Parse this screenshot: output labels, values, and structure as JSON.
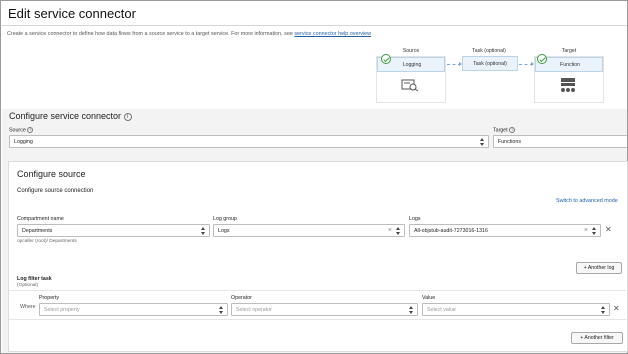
{
  "header": {
    "title": "Edit service connector",
    "intro": "Create a service connector to define how data flows from a source service to a target service. For more information, see ",
    "intro_link": "service connector help overview"
  },
  "flow": {
    "source_label": "Source",
    "source_value": "Logging",
    "task_label": "Task (optional)",
    "task_value": "Task (optional)",
    "target_label": "Target",
    "target_value": "Function"
  },
  "configure_connector": {
    "title": "Configure service connector",
    "source_label": "Source",
    "source_value": "Logging",
    "target_label": "Target",
    "target_value": "Functions"
  },
  "configure_source": {
    "title": "Configure source",
    "subtitle": "Configure source connection",
    "advanced_link": "Switch to advanced mode",
    "compartment_label": "Compartment name",
    "compartment_value": "Departments",
    "compartment_path": "opcaller (root)/ Departments",
    "log_group_label": "Log group",
    "log_group_value": "Logs",
    "logs_label": "Logs",
    "logs_value": "All-objstub-audit-7273016-1316",
    "another_log": "Another log",
    "filter_title": "Log filter task",
    "filter_optional": "(Optional)",
    "where_label": "Where",
    "property_label": "Property",
    "property_placeholder": "Select property",
    "operator_label": "Operator",
    "operator_placeholder": "Select operator",
    "value_label": "Value",
    "value_placeholder": "Select value",
    "another_filter": "Another filter"
  },
  "icons": {
    "check": "check-circle-icon",
    "logging": "logging-icon",
    "function": "function-icon",
    "help": "help-icon",
    "clear": "clear-x-icon",
    "remove": "remove-x-icon",
    "plus": "plus-icon"
  },
  "colors": {
    "accent": "#1f5fa8",
    "flow_box": "#eaf3fb",
    "check": "#3d9b3d"
  }
}
